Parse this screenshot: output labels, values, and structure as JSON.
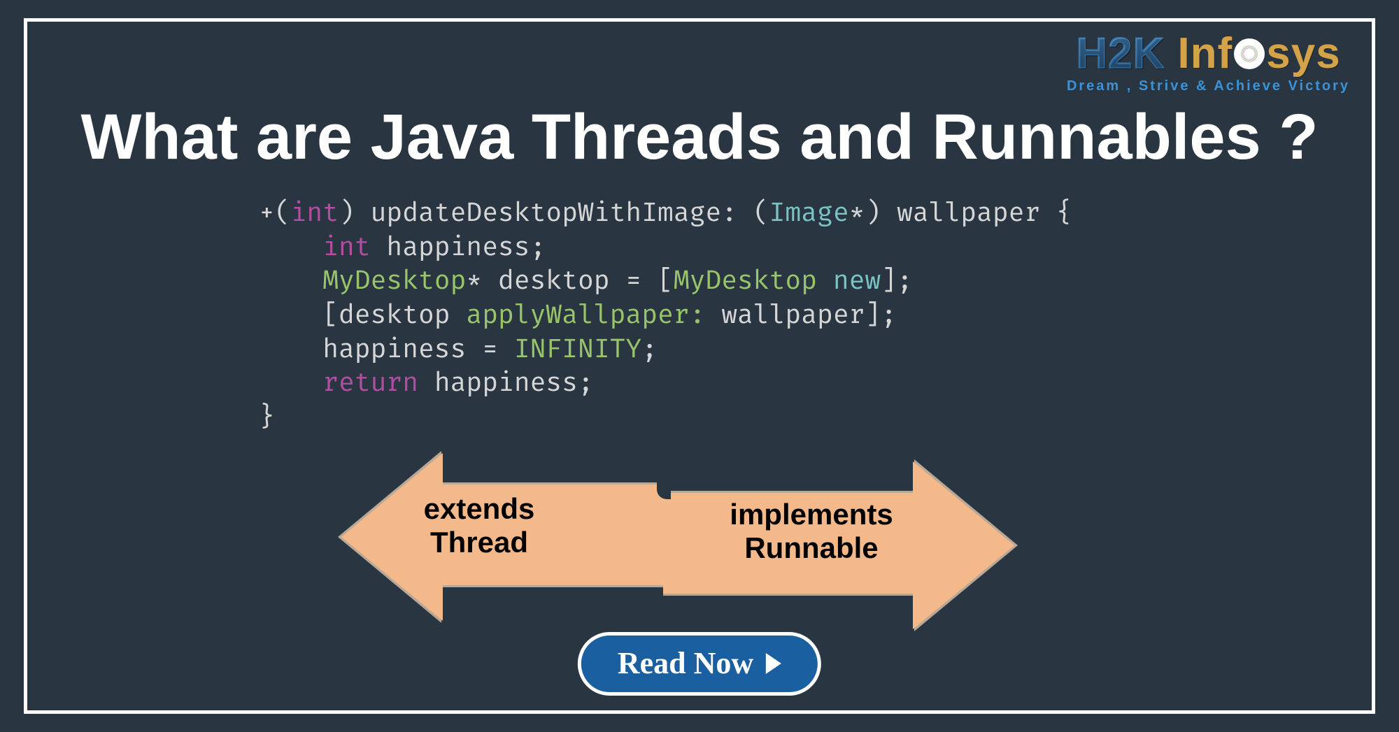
{
  "logo": {
    "part1": "H2K",
    "part2_pre": "Inf",
    "part2_post": "sys",
    "tagline": "Dream , Strive & Achieve Victory"
  },
  "title": "What are Java Threads and Runnables ?",
  "code": {
    "line1": {
      "a": "+(",
      "b": "int",
      "c": ") updateDesktopWithImage: (",
      "d": "Image",
      "e": "*) wallpaper {"
    },
    "line2": {
      "a": "    ",
      "b": "int",
      "c": " happiness;"
    },
    "line3": {
      "a": "    ",
      "b": "MyDesktop",
      "c": "* desktop = [",
      "d": "MyDesktop",
      "e": " ",
      "f": "new",
      "g": "];"
    },
    "line4": {
      "a": "    [desktop ",
      "b": "applyWallpaper:",
      "c": " wallpaper];"
    },
    "line5": {
      "a": "    happiness = ",
      "b": "INFINITY",
      "c": ";"
    },
    "line6": {
      "a": "    ",
      "b": "return",
      "c": " happiness;"
    },
    "line7": {
      "a": "}"
    }
  },
  "arrows": {
    "left": "extends\nThread",
    "right": "implements\nRunnable"
  },
  "cta": {
    "label": "Read Now"
  }
}
